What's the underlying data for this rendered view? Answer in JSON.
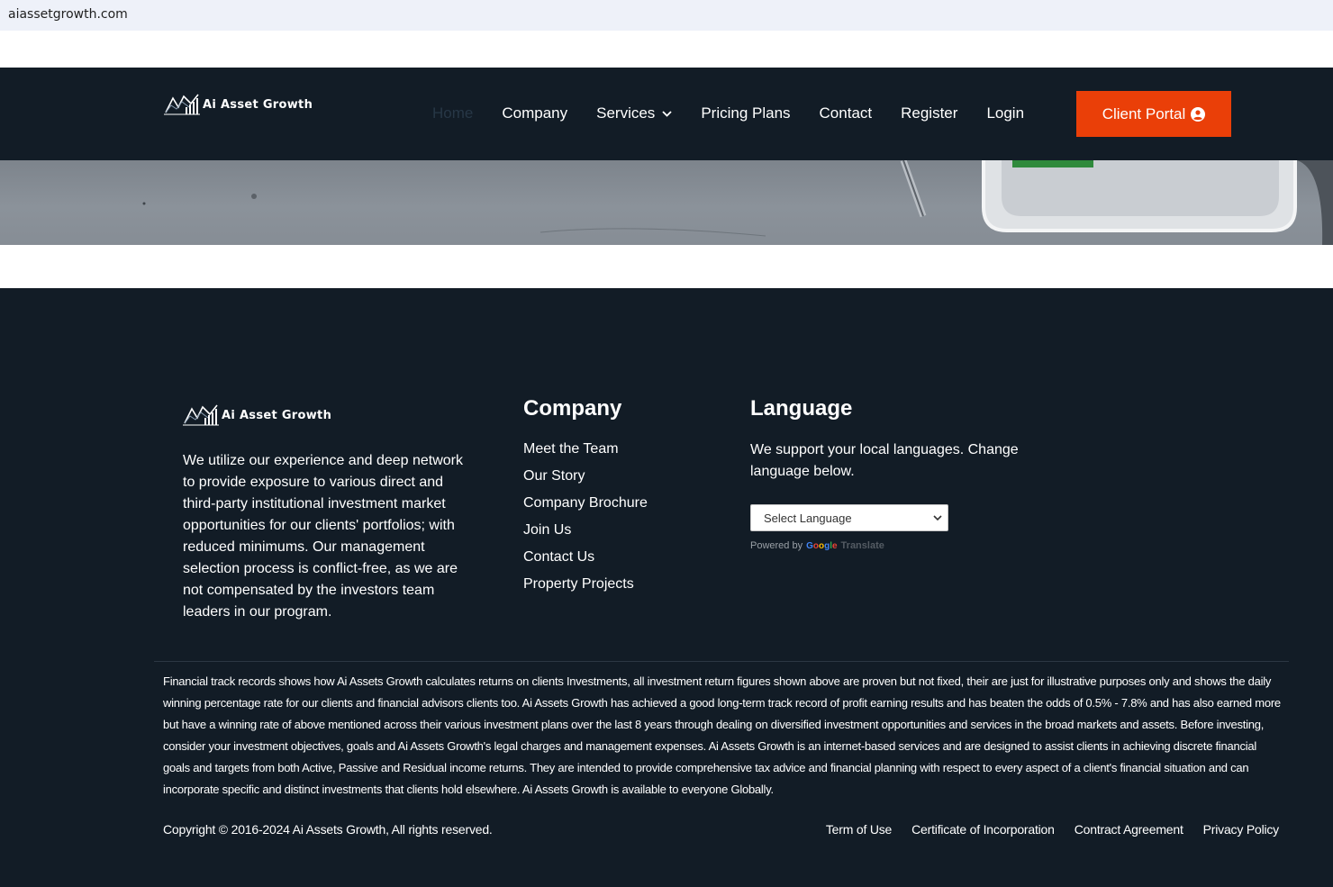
{
  "browser": {
    "url": "aiassetgrowth.com"
  },
  "brand": {
    "name": "Ai Asset Growth",
    "accent": "#ea3f08",
    "dark": "#121c26"
  },
  "nav": {
    "items": [
      {
        "label": "Home",
        "active": true
      },
      {
        "label": "Company"
      },
      {
        "label": "Services",
        "has_dropdown": true
      },
      {
        "label": "Pricing Plans"
      },
      {
        "label": "Contact"
      },
      {
        "label": "Register"
      },
      {
        "label": "Login"
      }
    ],
    "portal_button": "Client Portal"
  },
  "footer": {
    "about": "We utilize our experience and deep network to provide exposure to various direct and third-party institutional investment market opportunities for our clients' portfolios; with reduced minimums. Our management selection process is conflict-free, as we are not compensated by the investors team leaders in our program.",
    "company": {
      "title": "Company",
      "links": [
        "Meet the Team",
        "Our Story",
        "Company Brochure",
        "Join Us",
        "Contact Us",
        "Property Projects"
      ]
    },
    "language": {
      "title": "Language",
      "text": "We support your local languages. Change language below.",
      "select_value": "Select Language",
      "powered_by": "Powered by",
      "google": "Google",
      "translate": "Translate"
    },
    "disclaimer": "Financial track records shows how Ai Assets Growth calculates returns on clients Investments, all investment return figures shown above are proven but not fixed, their are just for illustrative purposes only and shows the daily winning percentage rate for our clients and financial advisors clients too. Ai Assets Growth has achieved a good long-term track record of profit earning results and has beaten the odds of 0.5% - 7.8% and has also earned more but have a winning rate of above mentioned across their various investment plans over the last 8 years through dealing on diversified investment opportunities and services in the broad markets and assets. Before investing, consider your investment objectives, goals and Ai Assets Growth's legal charges and management expenses. Ai Assets Growth is an internet-based services and are designed to assist clients in achieving discrete financial goals and targets from both Active, Passive and Residual income returns. They are intended to provide comprehensive tax advice and financial planning with respect to every aspect of a client's financial situation and can incorporate specific and distinct investments that clients hold elsewhere. Ai Assets Growth is available to everyone Globally.",
    "copyright": "Copyright © 2016-2024 Ai Assets Growth, All rights reserved.",
    "legal_links": [
      "Term of Use",
      "Certificate of Incorporation",
      "Contract Agreement",
      "Privacy Policy"
    ]
  }
}
